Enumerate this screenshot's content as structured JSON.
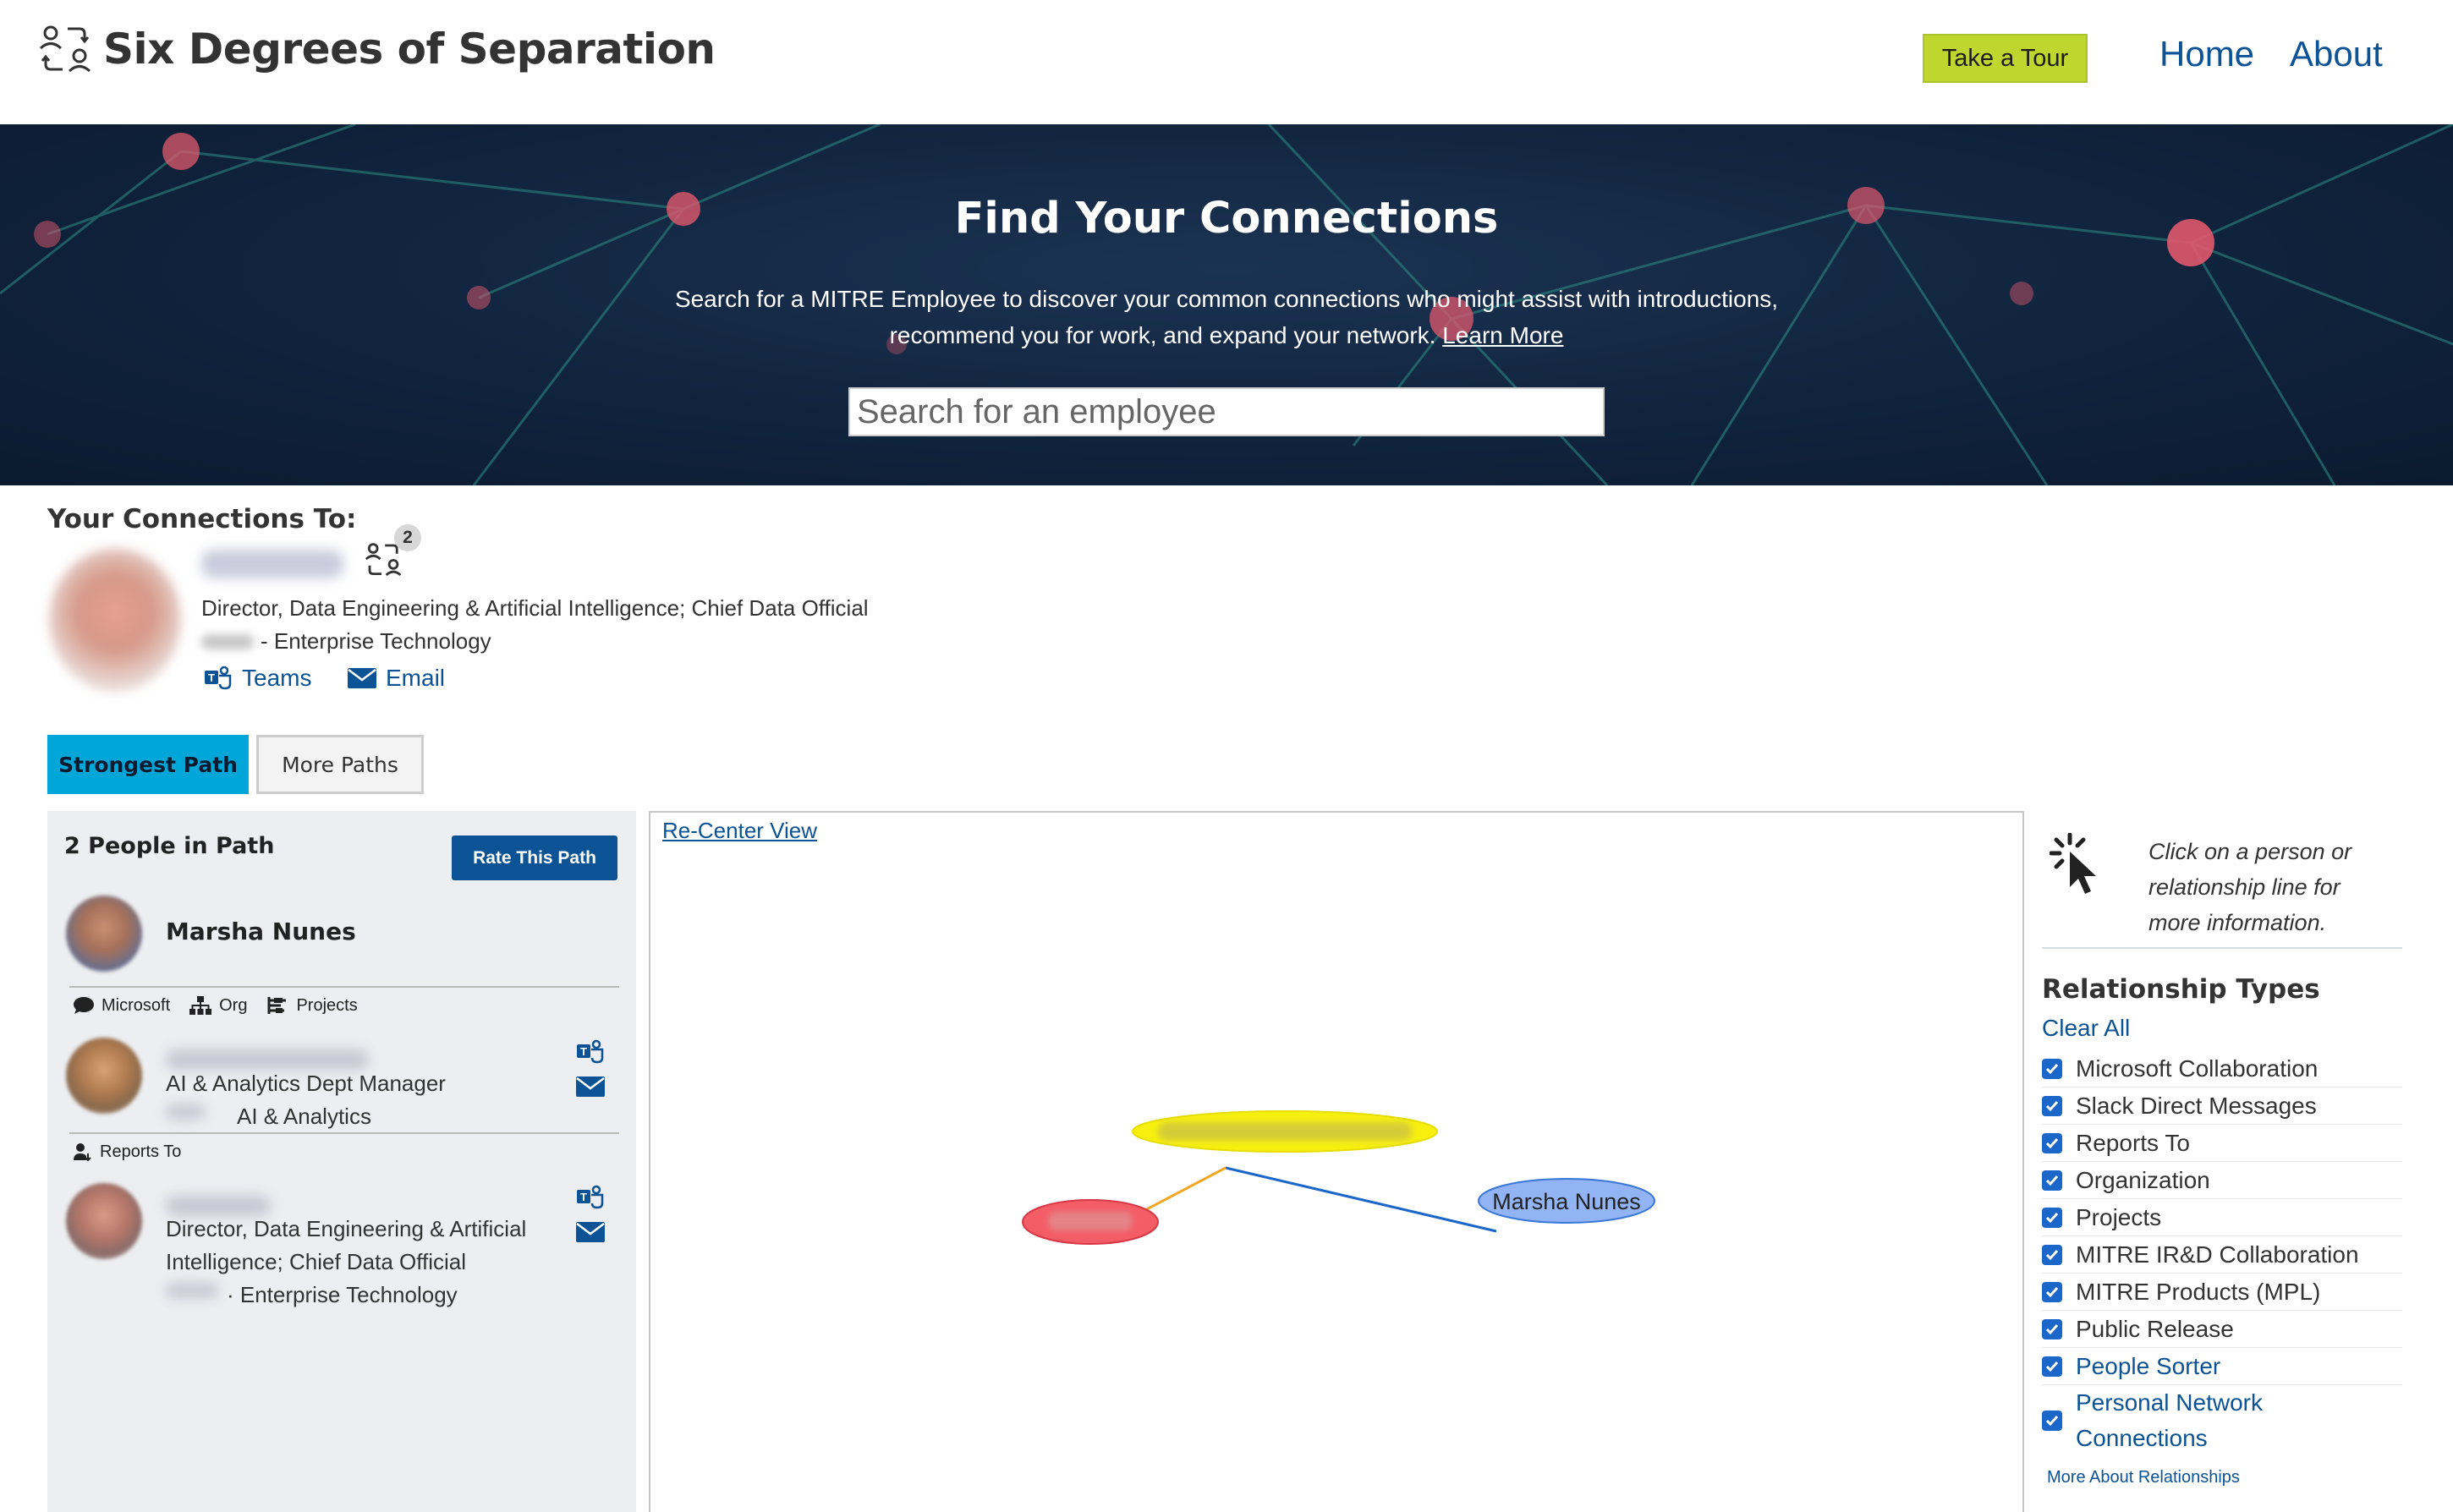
{
  "header": {
    "app_title": "Six Degrees of Separation",
    "tour_label": "Take a Tour",
    "nav": [
      {
        "label": "Home"
      },
      {
        "label": "About"
      }
    ]
  },
  "hero": {
    "title": "Find Your Connections",
    "subtitle_line1": "Search for a MITRE Employee to discover your common connections who might assist with introductions,",
    "subtitle_line2": "recommend you for work, and expand your network.",
    "learn_more": "Learn More",
    "search_placeholder": "Search for an employee"
  },
  "connection": {
    "label": "Your Connections To:",
    "badge_count": "2",
    "title": "Director, Data Engineering & Artificial Intelligence; Chief Data Official",
    "org": "- Enterprise Technology",
    "teams_label": "Teams",
    "email_label": "Email"
  },
  "tabs": [
    {
      "label": "Strongest Path",
      "active": true
    },
    {
      "label": "More Paths",
      "active": false
    }
  ],
  "path": {
    "title": "2 People in Path",
    "rate_label": "Rate This Path",
    "start_person": "Marsha Nunes",
    "links": [
      {
        "relations": [
          "Microsoft",
          "Org",
          "Projects"
        ],
        "title": "AI & Analytics Dept Manager",
        "org": "AI & Analytics"
      },
      {
        "relations": [
          "Reports To"
        ],
        "title_line1": "Director, Data Engineering & Artificial",
        "title_line2": "Intelligence; Chief Data Official",
        "org": "· Enterprise Technology"
      }
    ]
  },
  "graph": {
    "recenter_label": "Re-Center View",
    "nodes": [
      {
        "id": "marsha",
        "label": "Marsha Nunes",
        "color": "#92b4f4"
      },
      {
        "id": "middle",
        "label": "",
        "color": "#f7f00f"
      },
      {
        "id": "target",
        "label": "",
        "color": "#f45c66"
      }
    ],
    "edges": [
      {
        "from": "middle",
        "to": "marsha",
        "color": "#1a66c9"
      },
      {
        "from": "middle",
        "to": "target",
        "color": "#f5a623"
      }
    ]
  },
  "sidebar": {
    "hint_line1": "Click on a person or",
    "hint_line2": "relationship line for",
    "hint_line3": "more information.",
    "rel_title": "Relationship Types",
    "clear_all": "Clear All",
    "types": [
      {
        "label": "Microsoft Collaboration",
        "checked": true,
        "link": false
      },
      {
        "label": "Slack Direct Messages",
        "checked": true,
        "link": false
      },
      {
        "label": "Reports To",
        "checked": true,
        "link": false
      },
      {
        "label": "Organization",
        "checked": true,
        "link": false
      },
      {
        "label": "Projects",
        "checked": true,
        "link": false
      },
      {
        "label": "MITRE IR&D Collaboration",
        "checked": true,
        "link": false
      },
      {
        "label": "MITRE Products (MPL)",
        "checked": true,
        "link": false
      },
      {
        "label": "Public Release",
        "checked": true,
        "link": false
      },
      {
        "label": "People Sorter",
        "checked": true,
        "link": true
      },
      {
        "label": "Personal Network",
        "label2": "Connections",
        "checked": true,
        "link": true
      }
    ],
    "more_about": "More About Relationships"
  },
  "colors": {
    "accent": "#0b5394",
    "tab_active": "#00a6d8",
    "tour_button": "#bfd62f",
    "checkbox": "#1a66c9"
  }
}
